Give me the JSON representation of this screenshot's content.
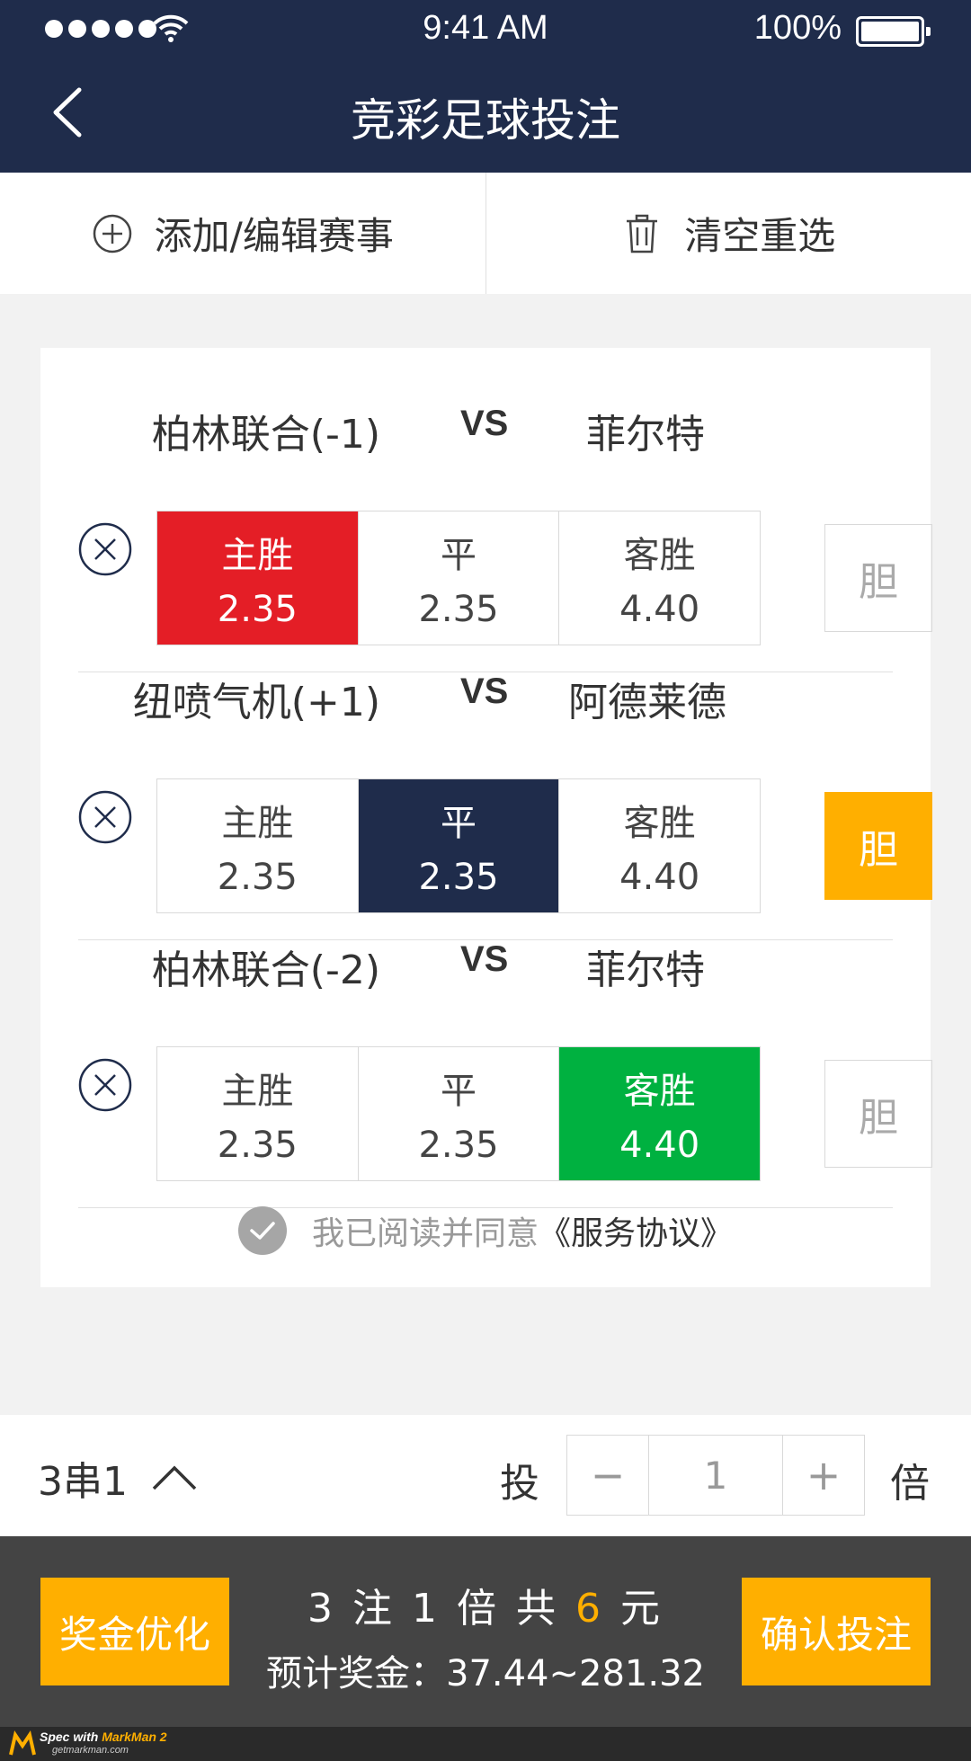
{
  "status_bar": {
    "time": "9:41 AM",
    "battery": "100%"
  },
  "header": {
    "title": "竞彩足球投注"
  },
  "toolbar": {
    "add_label": "添加/编辑赛事",
    "clear_label": "清空重选"
  },
  "matches": [
    {
      "home": "柏林联合(-1)",
      "vs": "VS",
      "away": "菲尔特",
      "odds": [
        {
          "label": "主胜",
          "value": "2.35",
          "selected": true
        },
        {
          "label": "平",
          "value": "2.35",
          "selected": false
        },
        {
          "label": "客胜",
          "value": "4.40",
          "selected": false
        }
      ],
      "dan": "胆",
      "dan_active": false
    },
    {
      "home": "纽喷气机(+1)",
      "vs": "VS",
      "away": "阿德莱德",
      "odds": [
        {
          "label": "主胜",
          "value": "2.35",
          "selected": false
        },
        {
          "label": "平",
          "value": "2.35",
          "selected": true
        },
        {
          "label": "客胜",
          "value": "4.40",
          "selected": false
        }
      ],
      "dan": "胆",
      "dan_active": true
    },
    {
      "home": "柏林联合(-2)",
      "vs": "VS",
      "away": "菲尔特",
      "odds": [
        {
          "label": "主胜",
          "value": "2.35",
          "selected": false
        },
        {
          "label": "平",
          "value": "2.35",
          "selected": false
        },
        {
          "label": "客胜",
          "value": "4.40",
          "selected": true
        }
      ],
      "dan": "胆",
      "dan_active": false
    }
  ],
  "agreement": {
    "text": "我已阅读并同意",
    "link": "《服务协议》"
  },
  "bet": {
    "combo": "3串1",
    "tou": "投",
    "minus": "−",
    "multiple": "1",
    "plus": "+",
    "bei": "倍"
  },
  "footer": {
    "optimize_label": "奖金优化",
    "summary_a": "3 注 1 倍  共 ",
    "summary_amount": "6",
    "summary_b": " 元",
    "prize": "预计奖金：37.44~281.32",
    "confirm_label": "确认投注"
  },
  "watermark": {
    "line1a": "Spec with ",
    "line1b": "MarkMan 2",
    "line2": "getmarkman.com"
  },
  "colors": {
    "navy": "#1f2c4b",
    "red": "#e41e26",
    "green": "#00b140",
    "orange": "#ffaf00"
  }
}
